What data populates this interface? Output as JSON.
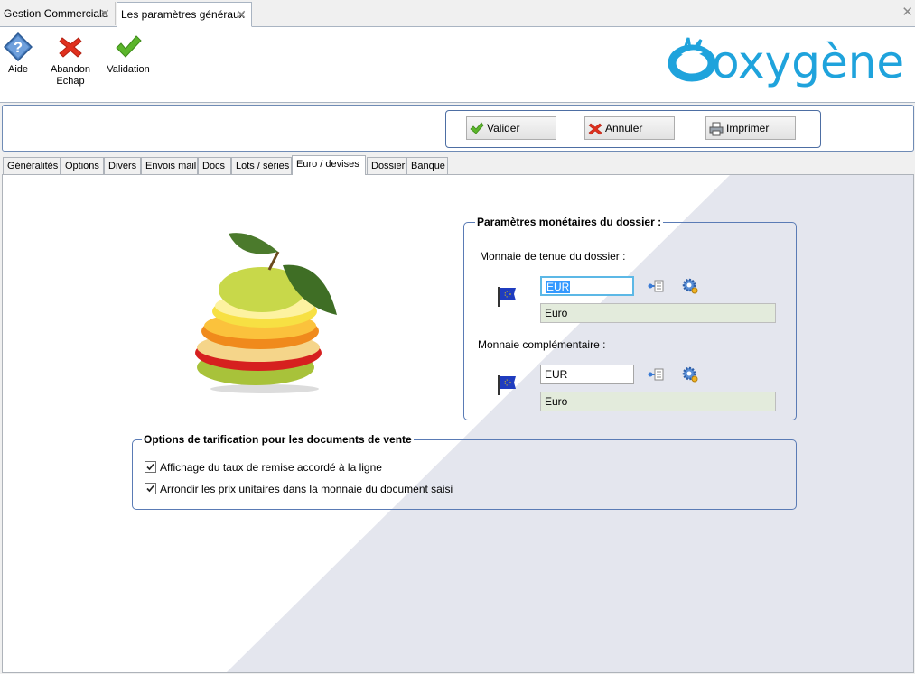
{
  "doc_tabs": [
    {
      "label": "Gestion Commerciale"
    },
    {
      "label": "Les paramètres généraux"
    }
  ],
  "toolbar": {
    "help_label": "Aide",
    "abort_label_1": "Abandon",
    "abort_label_2": "Echap",
    "validate_label": "Validation"
  },
  "brand": {
    "logo_text": "oxygène",
    "color": "#1fa3dc"
  },
  "actions": {
    "validate": "Valider",
    "cancel": "Annuler",
    "print": "Imprimer"
  },
  "tabs": [
    {
      "label": "Généralités"
    },
    {
      "label": "Options"
    },
    {
      "label": "Divers"
    },
    {
      "label": "Envois mail"
    },
    {
      "label": "Docs"
    },
    {
      "label": "Lots / séries"
    },
    {
      "label": "Euro / devises"
    },
    {
      "label": "Dossier"
    },
    {
      "label": "Banque"
    }
  ],
  "active_tab": "Euro / devises",
  "currency_group": {
    "title": "Paramètres monétaires du dossier :",
    "main_label": "Monnaie de tenue du dossier :",
    "main_code": "EUR",
    "main_name": "Euro",
    "comp_label": "Monnaie complémentaire :",
    "comp_code": "EUR",
    "comp_name": "Euro"
  },
  "pricing_group": {
    "title": "Options de tarification pour les documents de vente",
    "options": [
      {
        "label": "Affichage du taux de remise accordé à la ligne",
        "checked": true
      },
      {
        "label": "Arrondir les prix unitaires dans la monnaie du document saisi",
        "checked": true
      }
    ]
  },
  "icons": {
    "help": "help-icon",
    "abort": "cross-icon",
    "validate": "check-icon",
    "print": "printer-icon",
    "flag": "eu-flag-icon",
    "lookup": "lookup-icon",
    "settings": "gear-icon"
  }
}
